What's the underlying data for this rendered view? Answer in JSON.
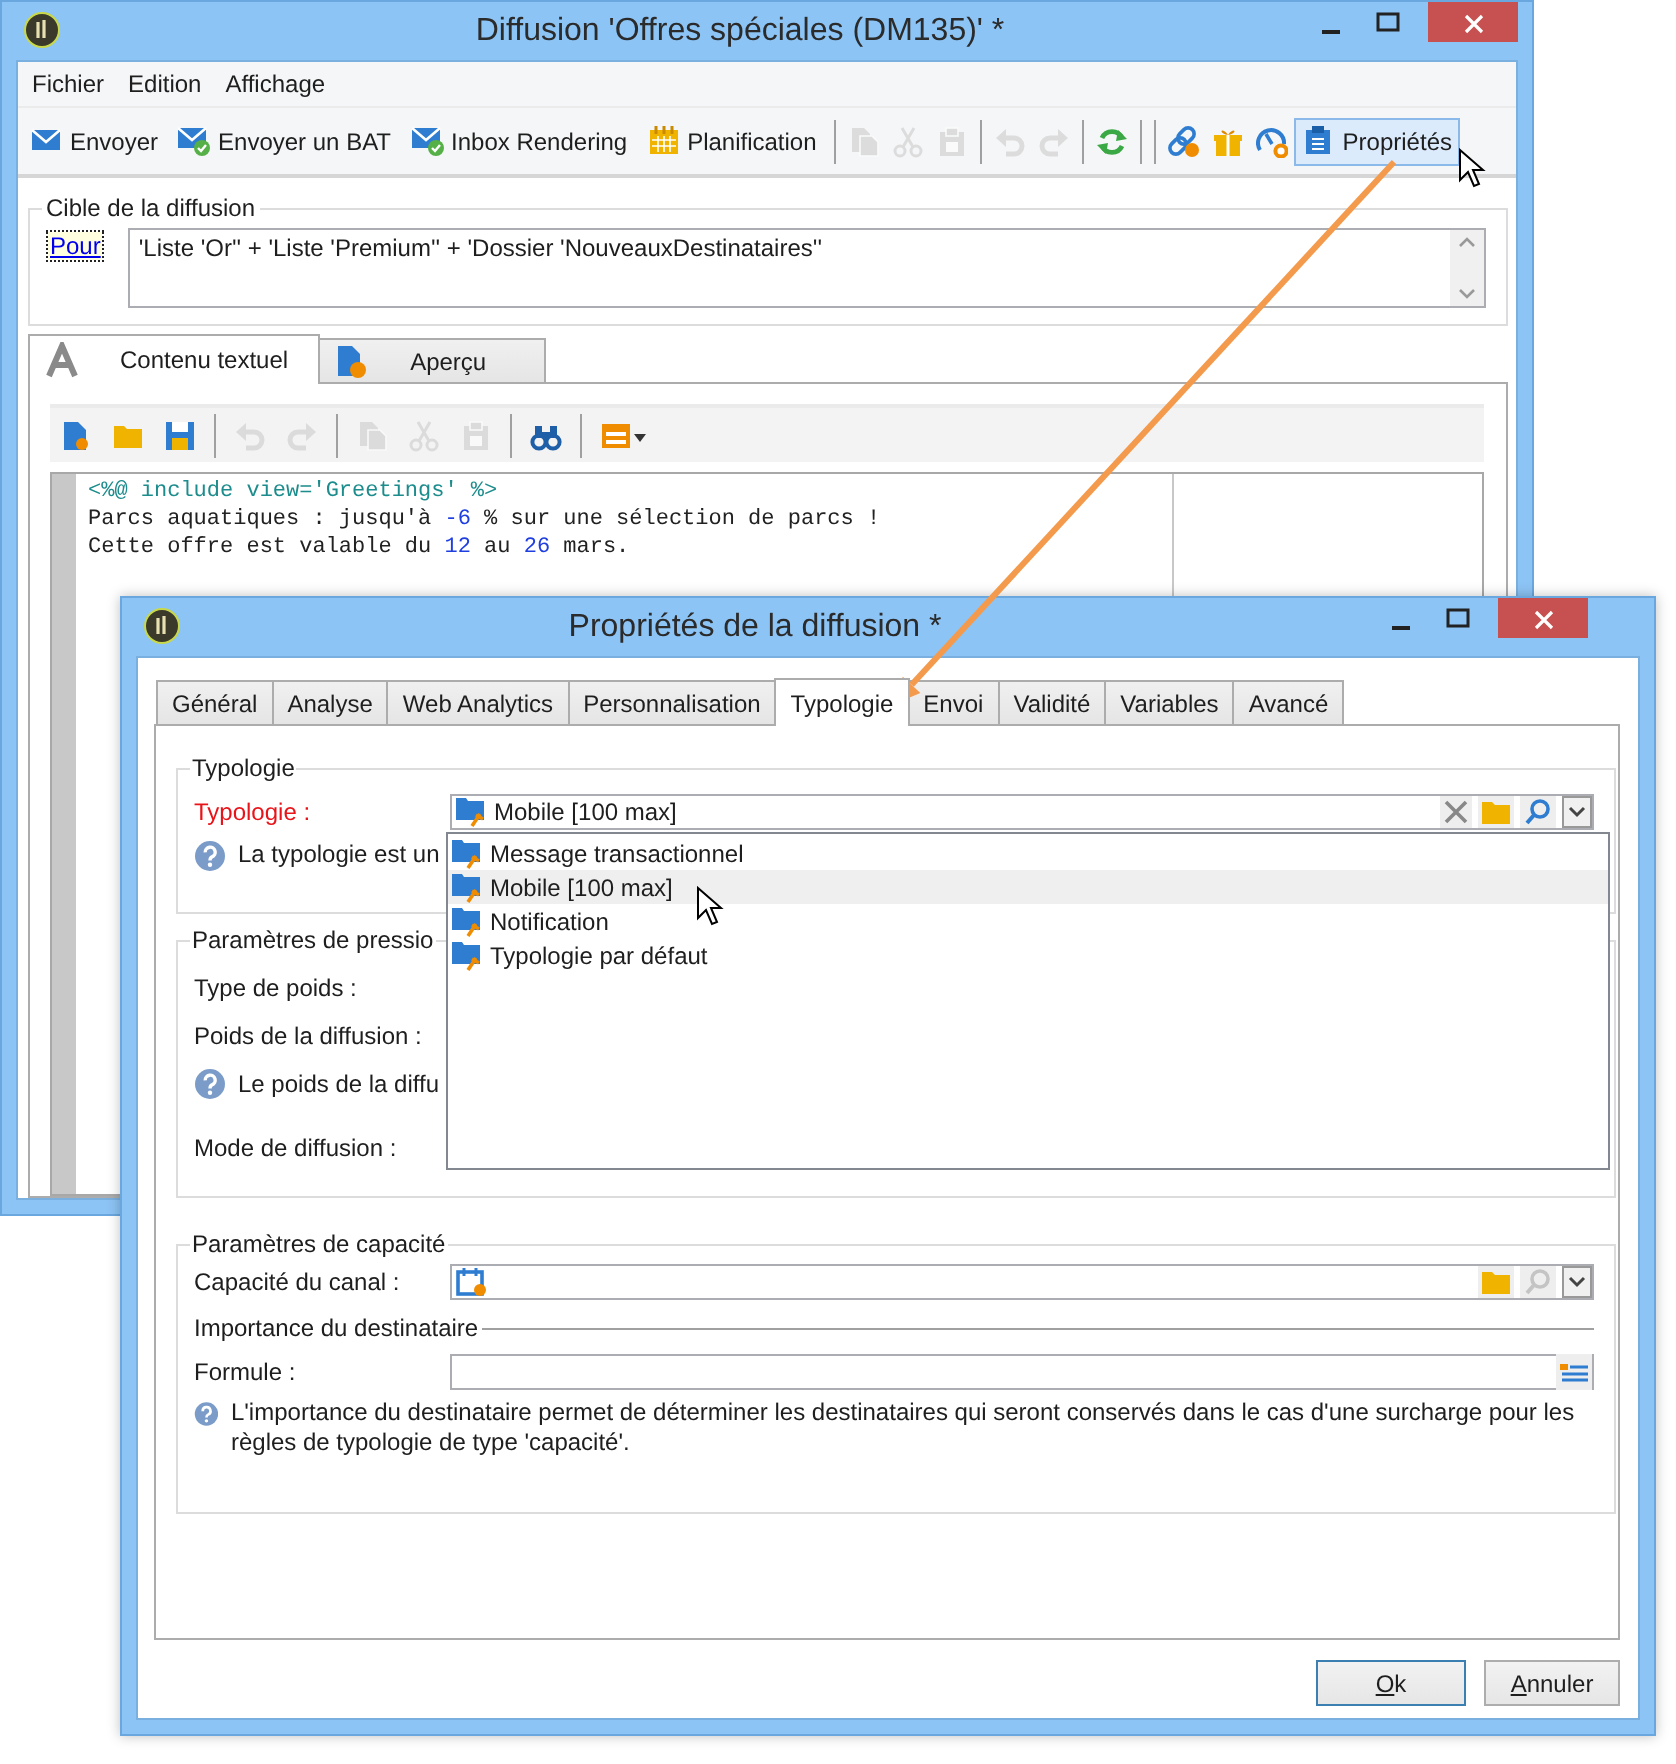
{
  "main_window": {
    "title": "Diffusion 'Offres spéciales (DM135)' *",
    "menu": [
      "Fichier",
      "Edition",
      "Affichage"
    ],
    "toolbar": [
      {
        "kind": "button",
        "label": "Envoyer",
        "hovered": false
      },
      {
        "kind": "button",
        "label": "Envoyer un BAT",
        "hovered": false
      },
      {
        "kind": "button",
        "label": "Inbox Rendering",
        "hovered": false
      },
      {
        "kind": "button",
        "label": "Planification",
        "hovered": false
      },
      {
        "kind": "separator"
      },
      {
        "kind": "icon",
        "disabled": true
      },
      {
        "kind": "icon",
        "disabled": true
      },
      {
        "kind": "icon",
        "disabled": true
      },
      {
        "kind": "separator"
      },
      {
        "kind": "icon",
        "disabled": true
      },
      {
        "kind": "icon",
        "disabled": true
      },
      {
        "kind": "separator"
      },
      {
        "kind": "icon",
        "disabled": false
      },
      {
        "kind": "separator"
      },
      {
        "kind": "separator"
      },
      {
        "kind": "icon",
        "disabled": false
      },
      {
        "kind": "icon",
        "disabled": false
      },
      {
        "kind": "icon",
        "disabled": false
      },
      {
        "kind": "button",
        "label": "Propriétés",
        "hovered": true
      }
    ],
    "target": {
      "title": "Cible de la diffusion",
      "link": "Pour",
      "value": "'Liste 'Or'' + 'Liste 'Premium'' + 'Dossier 'NouveauxDestinataires''"
    },
    "tabs": [
      {
        "label": "Contenu textuel",
        "selected": true
      },
      {
        "label": "Aperçu",
        "selected": false
      }
    ],
    "editor_toolbar": [
      {
        "kind": "icon",
        "disabled": false
      },
      {
        "kind": "icon",
        "disabled": false
      },
      {
        "kind": "icon",
        "disabled": false
      },
      {
        "kind": "separator"
      },
      {
        "kind": "icon",
        "disabled": true
      },
      {
        "kind": "icon",
        "disabled": true
      },
      {
        "kind": "separator"
      },
      {
        "kind": "icon",
        "disabled": true
      },
      {
        "kind": "icon",
        "disabled": true
      },
      {
        "kind": "icon",
        "disabled": true
      },
      {
        "kind": "separator"
      },
      {
        "kind": "icon",
        "disabled": false
      },
      {
        "kind": "separator"
      },
      {
        "kind": "icon",
        "disabled": false
      }
    ],
    "code_lines": [
      [
        {
          "kind": "directive",
          "text": "<%@ include view='Greetings' %>"
        }
      ],
      [
        {
          "kind": "plain",
          "text": "Parcs aquatiques : jusqu'à "
        },
        {
          "kind": "number",
          "text": "-6"
        },
        {
          "kind": "plain",
          "text": " % sur une sélection de parcs !"
        }
      ],
      [
        {
          "kind": "plain",
          "text": "Cette offre est valable du "
        },
        {
          "kind": "number",
          "text": "12"
        },
        {
          "kind": "plain",
          "text": " au "
        },
        {
          "kind": "number",
          "text": "26"
        },
        {
          "kind": "plain",
          "text": " mars."
        }
      ]
    ]
  },
  "dialog": {
    "title": "Propriétés de la diffusion *",
    "tabs": [
      {
        "label": "Général",
        "selected": false
      },
      {
        "label": "Analyse",
        "selected": false
      },
      {
        "label": "Web Analytics",
        "selected": false
      },
      {
        "label": "Personnalisation",
        "selected": false
      },
      {
        "label": "Typologie",
        "selected": true
      },
      {
        "label": "Envoi",
        "selected": false
      },
      {
        "label": "Validité",
        "selected": false
      },
      {
        "label": "Variables",
        "selected": false
      },
      {
        "label": "Avancé",
        "selected": false
      }
    ],
    "typology_group": {
      "title": "Typologie",
      "label": "Typologie :",
      "required": true,
      "value": "Mobile [100 max]",
      "help": "La typologie est un",
      "options": [
        {
          "label": "Message transactionnel",
          "selected": false
        },
        {
          "label": "Mobile [100 max]",
          "selected": true
        },
        {
          "label": "Notification",
          "selected": false
        },
        {
          "label": "Typologie par défaut",
          "selected": false
        }
      ]
    },
    "pressure_group": {
      "title": "Paramètres de pressio",
      "rows": [
        {
          "kind": "label",
          "text": "Type de poids :"
        },
        {
          "kind": "label",
          "text": "Poids de la diffusion :"
        },
        {
          "kind": "help",
          "text": "Le poids de la diffu"
        },
        {
          "kind": "label",
          "text": "Mode de diffusion :"
        }
      ]
    },
    "capacity_group": {
      "title": "Paramètres de capacité",
      "channel_label": "Capacité du canal :",
      "subheading": "Importance du destinataire",
      "formula_label": "Formule :",
      "help": "L'importance du destinataire permet de déterminer les destinataires qui seront conservés dans le cas d'une surcharge pour les règles de typologie de type 'capacité'."
    },
    "buttons": [
      {
        "label": "Ok",
        "default": true
      },
      {
        "label": "Annuler",
        "default": false
      }
    ]
  }
}
